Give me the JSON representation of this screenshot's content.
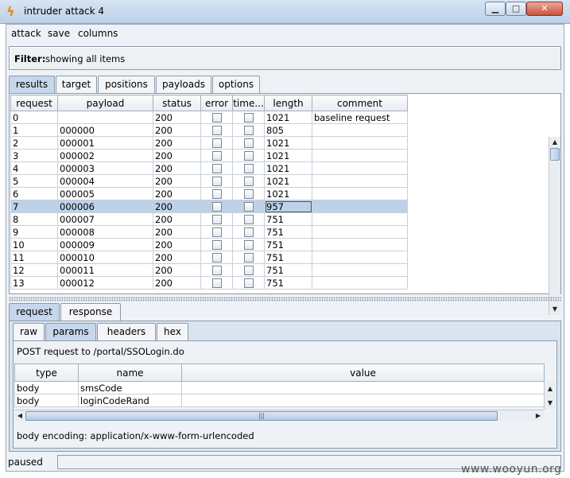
{
  "window": {
    "title": "intruder attack 4",
    "min_glyph": "□",
    "max_glyph": "□",
    "close_glyph": "✕"
  },
  "menu": [
    "attack",
    "save",
    "columns"
  ],
  "filter": {
    "label": "Filter:",
    "text": "showing all items"
  },
  "top_tabs": [
    "results",
    "target",
    "positions",
    "payloads",
    "options"
  ],
  "active_top_tab": "results",
  "results": {
    "columns": [
      "request",
      "payload",
      "status",
      "error",
      "time...",
      "length",
      "comment"
    ],
    "rows": [
      {
        "request": "0",
        "payload": "",
        "status": "200",
        "length": "1021",
        "comment": "baseline request"
      },
      {
        "request": "1",
        "payload": "000000",
        "status": "200",
        "length": "805",
        "comment": ""
      },
      {
        "request": "2",
        "payload": "000001",
        "status": "200",
        "length": "1021",
        "comment": ""
      },
      {
        "request": "3",
        "payload": "000002",
        "status": "200",
        "length": "1021",
        "comment": ""
      },
      {
        "request": "4",
        "payload": "000003",
        "status": "200",
        "length": "1021",
        "comment": ""
      },
      {
        "request": "5",
        "payload": "000004",
        "status": "200",
        "length": "1021",
        "comment": ""
      },
      {
        "request": "6",
        "payload": "000005",
        "status": "200",
        "length": "1021",
        "comment": ""
      },
      {
        "request": "7",
        "payload": "000006",
        "status": "200",
        "length": "957",
        "comment": ""
      },
      {
        "request": "8",
        "payload": "000007",
        "status": "200",
        "length": "751",
        "comment": ""
      },
      {
        "request": "9",
        "payload": "000008",
        "status": "200",
        "length": "751",
        "comment": ""
      },
      {
        "request": "10",
        "payload": "000009",
        "status": "200",
        "length": "751",
        "comment": ""
      },
      {
        "request": "11",
        "payload": "000010",
        "status": "200",
        "length": "751",
        "comment": ""
      },
      {
        "request": "12",
        "payload": "000011",
        "status": "200",
        "length": "751",
        "comment": ""
      },
      {
        "request": "13",
        "payload": "000012",
        "status": "200",
        "length": "751",
        "comment": ""
      }
    ],
    "selected_request": "7"
  },
  "detail_tabs": [
    "request",
    "response"
  ],
  "active_detail_tab": "request",
  "request_tabs": [
    "raw",
    "params",
    "headers",
    "hex"
  ],
  "active_request_tab": "params",
  "params": {
    "post_line": "POST request to /portal/SSOLogin.do",
    "columns": [
      "type",
      "name",
      "value"
    ],
    "rows": [
      {
        "type": "body",
        "name": "smsCode",
        "value": ""
      },
      {
        "type": "body",
        "name": "loginCodeRand",
        "value": ""
      }
    ],
    "encoding": "body encoding:  application/x-www-form-urlencoded"
  },
  "status": "paused",
  "watermark": "www.wooyun.org",
  "colors": {
    "active_tab": "#c6d7ec",
    "selected_row": "#bdd1e8",
    "panel_bg": "#eef2f6"
  }
}
